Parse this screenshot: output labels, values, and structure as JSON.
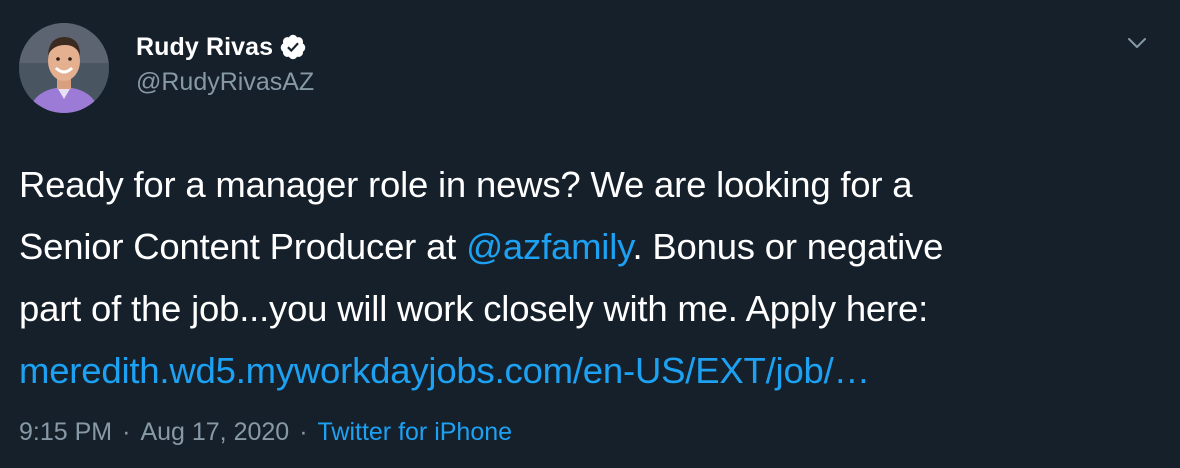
{
  "author": {
    "display_name": "Rudy Rivas",
    "handle": "@RudyRivasAZ",
    "verified": true,
    "avatar_icon": "profile-photo"
  },
  "tweet": {
    "lines": [
      [
        {
          "text": "Ready for a manager role in news? We are looking for a",
          "type": "text"
        }
      ],
      [
        {
          "text": "Senior Content Producer at ",
          "type": "text"
        },
        {
          "text": "@azfamily",
          "type": "mention"
        },
        {
          "text": ". Bonus or negative",
          "type": "text"
        }
      ],
      [
        {
          "text": "part of the job...you will work closely with me. Apply here:",
          "type": "text"
        }
      ],
      [
        {
          "text": "meredith.wd5.myworkdayjobs.com/en-US/EXT/job/…",
          "type": "link"
        }
      ]
    ]
  },
  "meta": {
    "time": "9:15 PM",
    "separator": "·",
    "date": "Aug 17, 2020",
    "source": "Twitter for iPhone"
  },
  "colors": {
    "background": "#15202b",
    "text": "#ffffff",
    "secondary": "#8899a6",
    "link": "#1da1f2",
    "verified_badge": "#ffffff"
  },
  "icons": {
    "verified": "verified-badge-icon",
    "caret": "chevron-down-icon"
  }
}
